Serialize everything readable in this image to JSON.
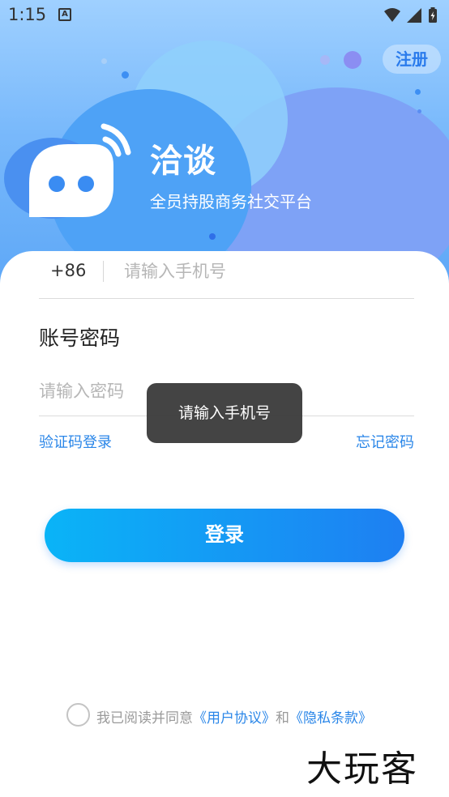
{
  "status_bar": {
    "time": "1:15",
    "notification_icon": "a-notification-icon",
    "icons": [
      "wifi-icon",
      "signal-icon",
      "battery-charging-icon"
    ]
  },
  "header": {
    "register_label": "注册",
    "app_name": "洽谈",
    "slogan": "全员持股商务社交平台",
    "logo_icon": "chat-bubble-wifi-logo"
  },
  "form": {
    "country_code": "+86",
    "phone_placeholder": "请输入手机号",
    "section_title": "账号密码",
    "password_placeholder": "请输入密码",
    "sms_login_link": "验证码登录",
    "forgot_password_link": "忘记密码",
    "login_button": "登录"
  },
  "agreement": {
    "prefix": "我已阅读并同意",
    "user_agreement": "《用户协议》",
    "conjunction": "和",
    "privacy_policy": "《隐私条款》"
  },
  "toast": {
    "message": "请输入手机号"
  },
  "watermark": "大玩客",
  "colors": {
    "accent": "#2a86e8",
    "button_gradient_start": "#0ab4f7",
    "button_gradient_end": "#1e7ff2",
    "hero_top": "#9fd0ff",
    "hero_bottom": "#5da7f7"
  }
}
